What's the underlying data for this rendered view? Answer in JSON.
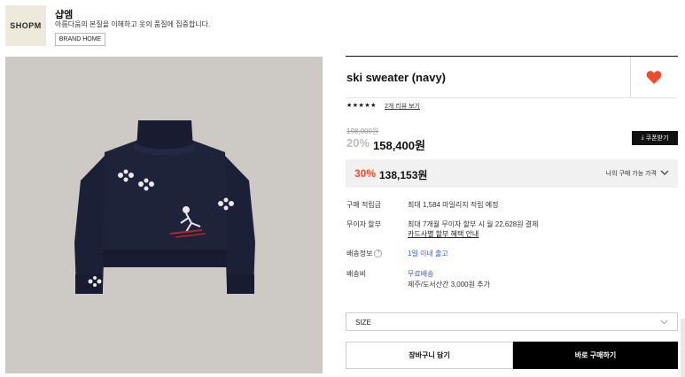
{
  "brand": {
    "logo_text": "SHOPM",
    "name": "샵엠",
    "description": "아름다움의 본질을 이해하고 옷의 품질에 집중합니다.",
    "home_button": "BRAND HOME"
  },
  "product": {
    "title": "ski sweater (navy)",
    "rating_stars": "★★★★★",
    "review_link": "2개 리뷰 보기",
    "original_price": "198,000원",
    "sale_rate": "20%",
    "sale_price": "158,400원",
    "coupon_button": "쿠폰받기",
    "best_rate": "30%",
    "best_price": "138,153원",
    "best_label": "나의 구매 가능 가격",
    "image_icon": "navy-turtleneck-sweater-image"
  },
  "info": {
    "points_label": "구매 적립금",
    "points_value": "최대 1,584 마일리지 적립 예정",
    "installment_label": "무이자 할부",
    "installment_value": "최대 7개월 무이자 할부 시 월 22,628원 결제",
    "installment_link": "카드사별 할부 혜택 안내",
    "shipping_label": "배송정보",
    "shipping_value": "1일 이내 출고",
    "fee_label": "배송비",
    "fee_value": "무료배송",
    "fee_extra": "제주/도서산간 3,000원 추가"
  },
  "options": {
    "size_label": "SIZE"
  },
  "actions": {
    "cart_button": "장바구니 담기",
    "buy_button": "바로 구매하기"
  },
  "colors": {
    "accent": "#ff4d2e",
    "heart": "#ee4d2d",
    "link_blue": "#3a5bd9",
    "sweater_navy": "#1c2036"
  }
}
